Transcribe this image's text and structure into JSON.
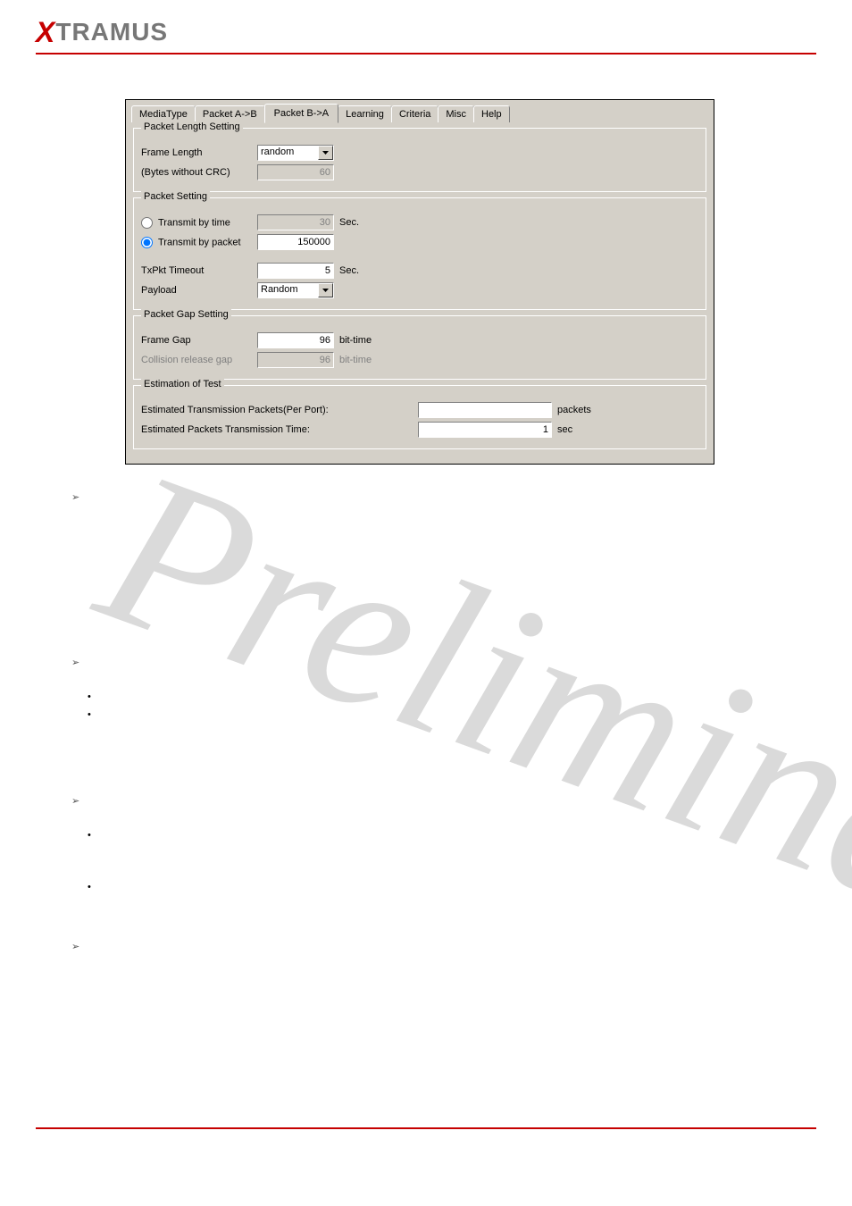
{
  "header": {
    "logo_x": "X",
    "logo_rest": "TRAMUS"
  },
  "tabs": {
    "mediatype": "MediaType",
    "packet_ab": "Packet A->B",
    "packet_ba": "Packet B->A",
    "learning": "Learning",
    "criteria": "Criteria",
    "misc": "Misc",
    "help": "Help"
  },
  "pkt_len": {
    "legend": "Packet Length Setting",
    "frame_length_label": "Frame Length",
    "frame_length_value": "random",
    "bytes_label": "(Bytes without CRC)",
    "bytes_value": "60"
  },
  "pkt_set": {
    "legend": "Packet Setting",
    "transmit_time_label": "Transmit by time",
    "transmit_time_value": "30",
    "transmit_time_unit": "Sec.",
    "transmit_packet_label": "Transmit by packet",
    "transmit_packet_value": "150000",
    "txpkt_timeout_label": "TxPkt Timeout",
    "txpkt_timeout_value": "5",
    "txpkt_timeout_unit": "Sec.",
    "payload_label": "Payload",
    "payload_value": "Random"
  },
  "pkt_gap": {
    "legend": "Packet Gap Setting",
    "frame_gap_label": "Frame Gap",
    "frame_gap_value": "96",
    "frame_gap_unit": "bit-time",
    "collision_label": "Collision release gap",
    "collision_value": "96",
    "collision_unit": "bit-time"
  },
  "estimation": {
    "legend": "Estimation of Test",
    "etp_label": "Estimated Transmission Packets(Per Port):",
    "etp_value": "",
    "etp_unit": "packets",
    "ept_label": "Estimated Packets Transmission Time:",
    "ept_value": "1",
    "ept_unit": "sec"
  },
  "watermark": "Preliminary"
}
